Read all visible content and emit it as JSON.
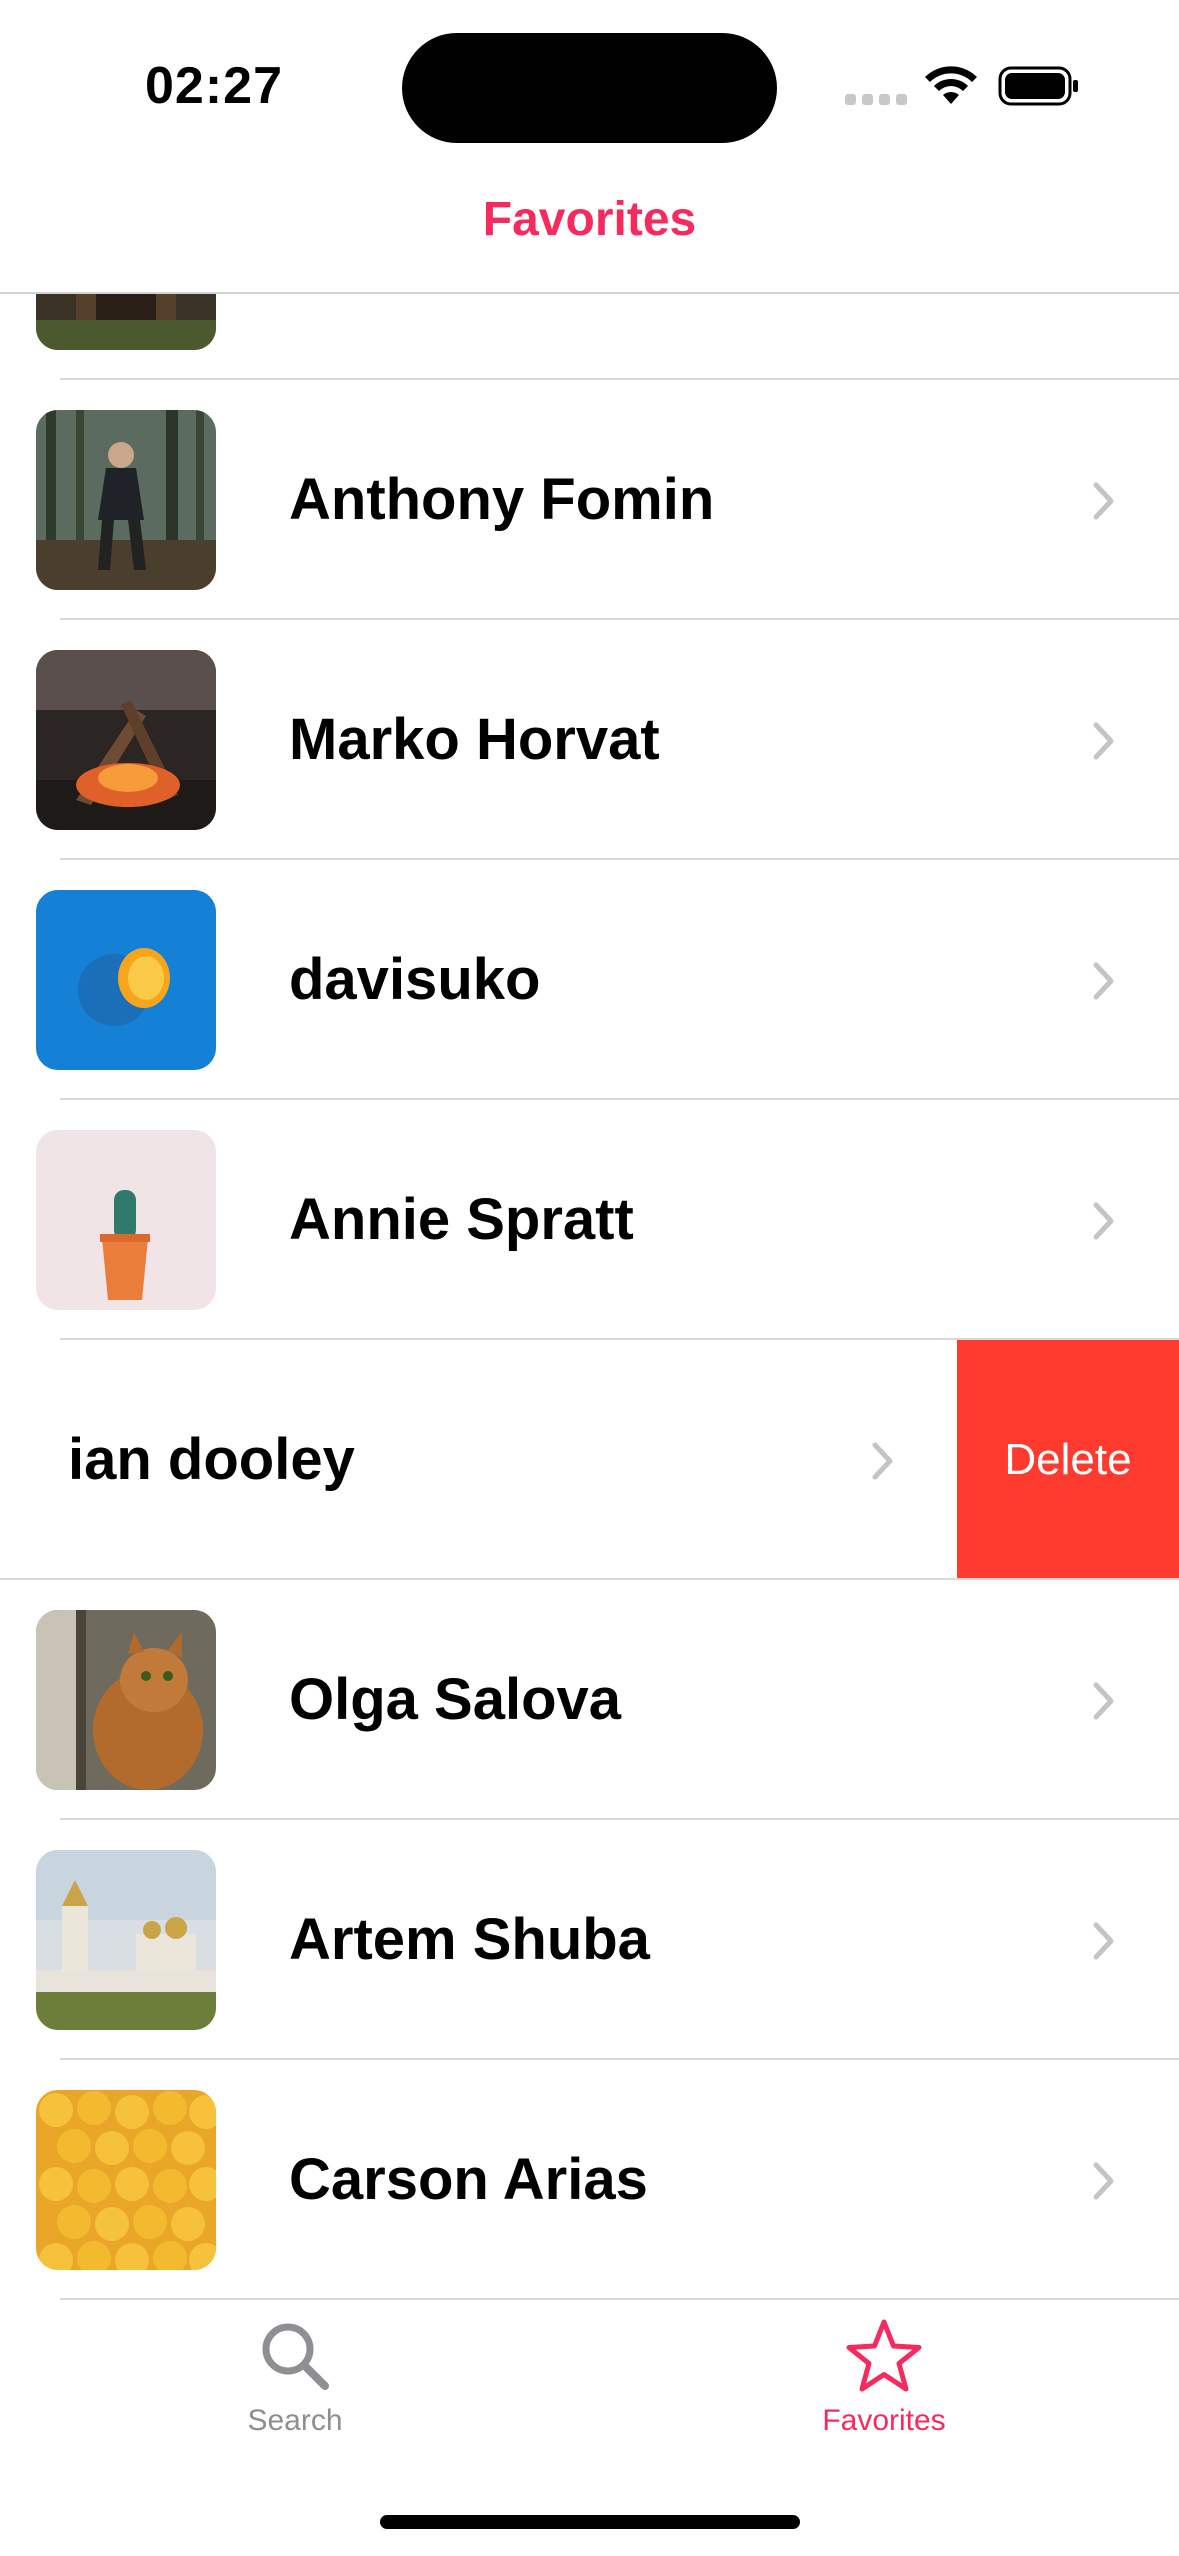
{
  "status_bar": {
    "time": "02:27"
  },
  "nav": {
    "title": "Favorites"
  },
  "rows": [
    {
      "name": ""
    },
    {
      "name": "Anthony Fomin"
    },
    {
      "name": "Marko Horvat"
    },
    {
      "name": "davisuko"
    },
    {
      "name": "Annie Spratt"
    },
    {
      "name": "ian dooley",
      "swiped": true
    },
    {
      "name": "Olga Salova"
    },
    {
      "name": "Artem Shuba"
    },
    {
      "name": "Carson Arias"
    }
  ],
  "row_actions": {
    "delete_label": "Delete",
    "delete_color": "#ff3b30"
  },
  "tabbar": {
    "search_label": "Search",
    "favorites_label": "Favorites",
    "selected": "Favorites"
  },
  "colors": {
    "accent": "#f52b5f",
    "inactive": "#8e8e93"
  },
  "icons": [
    "search-icon",
    "star-icon",
    "chevron-right-icon",
    "wifi-icon",
    "battery-icon"
  ]
}
